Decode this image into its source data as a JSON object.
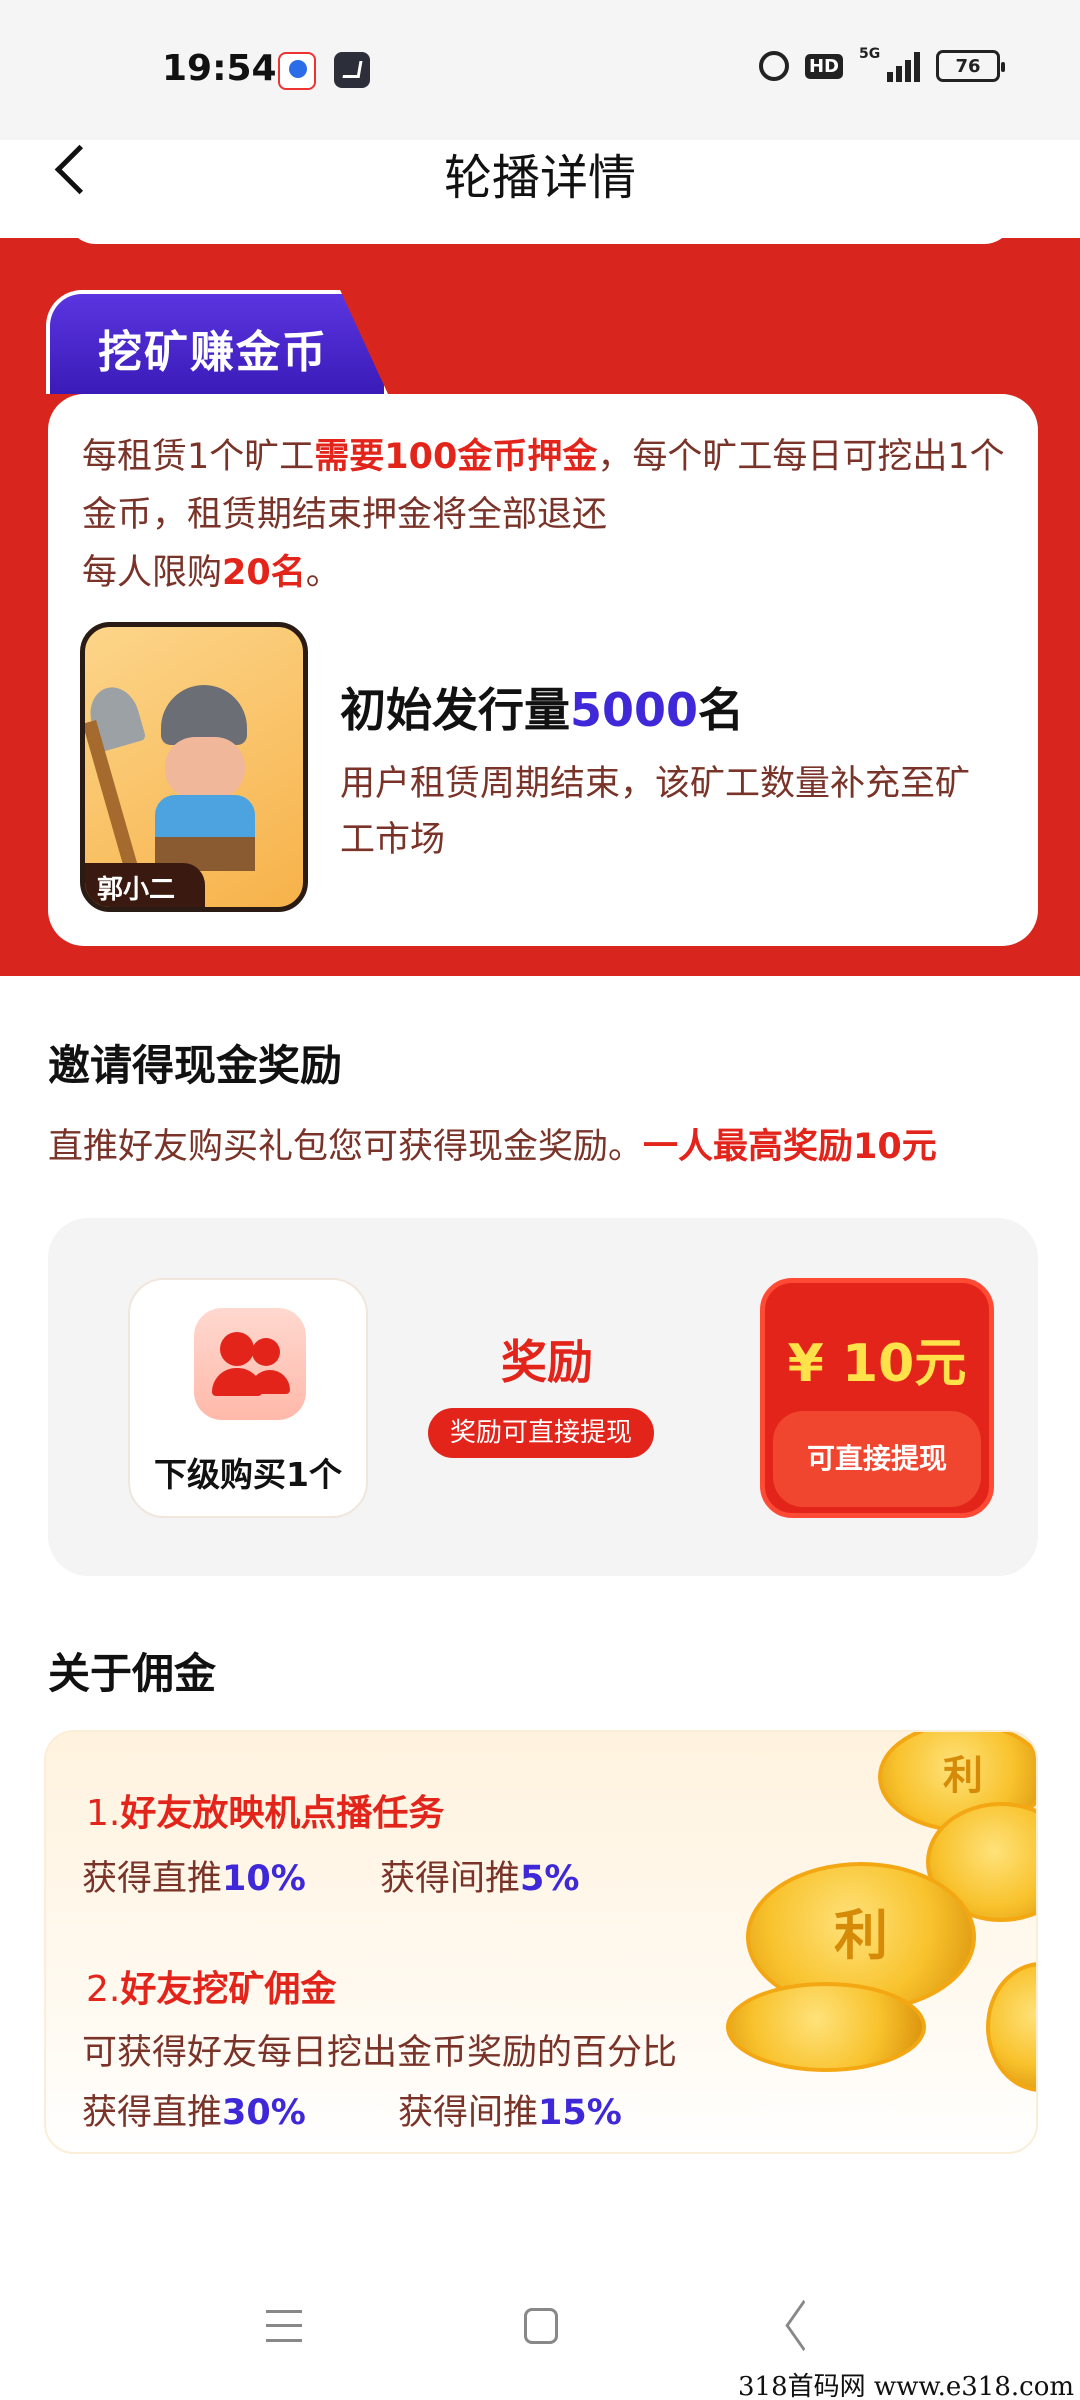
{
  "status_bar": {
    "time": "19:54",
    "hd_label": "HD",
    "network": "5G",
    "battery": "76"
  },
  "header": {
    "title": "轮播详情"
  },
  "mining": {
    "badge": "挖矿赚金币",
    "desc_a": "每租赁1个旷工",
    "desc_hl1": "需要100金币押金",
    "desc_b": "，每个旷工每日可挖出1个金币，租赁期结束押金将全部退还",
    "desc_c": "每人限购",
    "desc_hl2": "20名",
    "desc_d": "。",
    "avatar_tag": "郭小二",
    "issue_prefix": "初始发行量",
    "issue_num": "5000",
    "issue_suffix": "名",
    "issue_desc": "用户租赁周期结束，该矿工数量补充至矿工市场"
  },
  "invite": {
    "title": "邀请得现金奖励",
    "desc": "直推好友购买礼包您可获得现金奖励。",
    "desc_hl": "一人最高奖励10元",
    "friend_label": "下级购买1个",
    "reward_word": "奖励",
    "reward_pill": "奖励可直接提现",
    "cash_amount": "¥ 10元",
    "cash_button": "可直接提现"
  },
  "commission": {
    "title": "关于佣金",
    "item1_num": "1.",
    "item1_title": "好友放映机点播任务",
    "item1_direct_label": "获得直推",
    "item1_direct_pct": "10%",
    "item1_indirect_label": "获得间推",
    "item1_indirect_pct": "5%",
    "item2_num": "2.",
    "item2_title": "好友挖矿佣金",
    "item2_desc": "可获得好友每日挖出金币奖励的百分比",
    "item2_direct_label": "获得直推",
    "item2_direct_pct": "30%",
    "item2_indirect_label": "获得间推",
    "item2_indirect_pct": "15%",
    "coin_glyph": "利"
  },
  "watermark": "318首码网 www.e318.com",
  "colors": {
    "red": "#d8261e",
    "accent_red": "#e3241b",
    "purple": "#3e28d8",
    "gold": "#f8c22c"
  }
}
